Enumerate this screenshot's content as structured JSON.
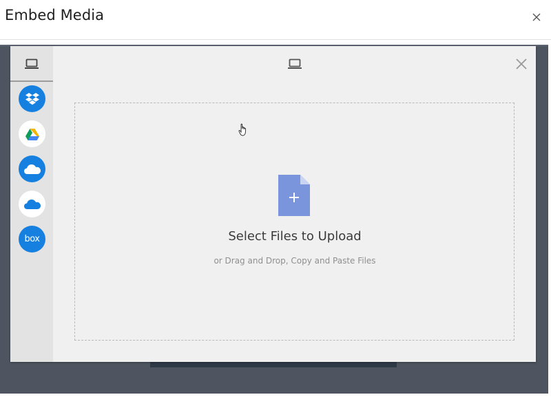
{
  "dialog": {
    "title": "Embed Media",
    "close_icon": "close-icon"
  },
  "picker": {
    "header_icon": "laptop-icon",
    "sidebar_active_icon": "laptop-icon",
    "close_icon": "close-icon",
    "sources": [
      {
        "name": "dropbox",
        "icon": "dropbox-icon",
        "bg": "#1680e0"
      },
      {
        "name": "google-drive",
        "icon": "google-drive-icon",
        "bg": "#ffffff"
      },
      {
        "name": "onedrive",
        "icon": "cloud-icon",
        "bg": "#1680e0"
      },
      {
        "name": "onedrive-business",
        "icon": "cloud-icon",
        "bg": "#ffffff"
      },
      {
        "name": "box",
        "icon": "box-icon",
        "bg": "#1680e0",
        "label": "box"
      }
    ],
    "dropzone": {
      "title": "Select Files to Upload",
      "subtitle": "or Drag and Drop, Copy and Paste Files",
      "file_icon_color": "#7b95dc"
    }
  },
  "colors": {
    "backdrop": "#4e5560",
    "picker_bg": "#f0f0f0",
    "sidebar_bg": "#e3e3e3",
    "accent_blue": "#1680e0"
  }
}
